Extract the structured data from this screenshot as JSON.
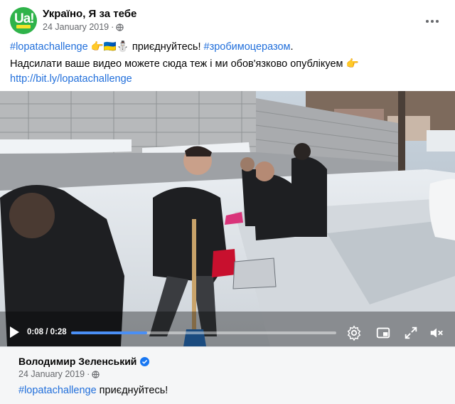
{
  "post": {
    "page_name": "Україно, Я за тебе",
    "date": "24 January 2019",
    "dot": "·",
    "avatar_text": "Ua!",
    "text_line1": {
      "hashtag1": "#lopatachallenge",
      "emojis": " 👉🇺🇦⛄ ",
      "middle": "приєднуйтесь! ",
      "hashtag2": "#зробимоцеразом",
      "end": "."
    },
    "text_line2": "Надсилати ваше видео можете сюда теж і ми обов'язково  опублікуем  👉",
    "link": "http://bit.ly/lopatachallenge"
  },
  "video": {
    "current_time": "0:08",
    "separator": " / ",
    "duration": "0:28",
    "progress_fraction": 0.286
  },
  "shared_from": {
    "name": "Володимир Зеленський",
    "date": "24 January 2019",
    "dot": "·",
    "hashtag": "#lopatachallenge",
    "text": " приєднуйтесь!"
  },
  "colors": {
    "link": "#216fdb",
    "avatar_bg": "#2fb34a",
    "progress": "#4a8ff5",
    "verified": "#1877f2"
  },
  "icons": [
    "globe-icon",
    "more-options-icon",
    "play-icon",
    "settings-icon",
    "picture-in-picture-icon",
    "fullscreen-icon",
    "volume-muted-icon",
    "verified-badge-icon"
  ]
}
